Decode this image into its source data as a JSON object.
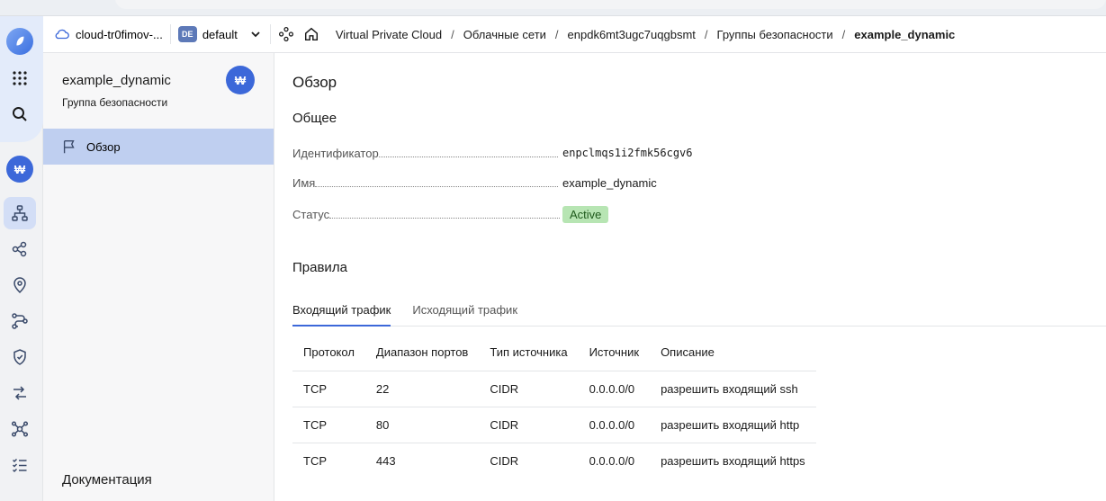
{
  "header": {
    "cloud_name": "cloud-tr0fimov-...",
    "folder_badge": "DE",
    "folder_name": "default",
    "breadcrumbs": [
      "Virtual Private Cloud",
      "Облачные сети",
      "enpdk6mt3ugc7uqgbsmt",
      "Группы безопасности",
      "example_dynamic"
    ],
    "breadcrumb_separator": "/"
  },
  "rail": {
    "avatar_letter": "₩",
    "icons": [
      "logo-icon",
      "apps-grid-icon",
      "search-icon",
      "avatar",
      "network-icon",
      "share-nodes-icon",
      "location-pin-icon",
      "routes-icon",
      "shield-icon",
      "transfer-arrows-icon",
      "cluster-icon",
      "checklist-icon"
    ]
  },
  "sidebar": {
    "title": "example_dynamic",
    "subtitle": "Группа безопасности",
    "avatar_letter": "₩",
    "items": [
      {
        "label": "Обзор",
        "icon": "flag-icon",
        "active": true
      }
    ],
    "docs_label": "Документация"
  },
  "main": {
    "page_title": "Обзор",
    "general": {
      "title": "Общее",
      "fields": [
        {
          "label": "Идентификатор",
          "value": "enpclmqs1i2fmk56cgv6"
        },
        {
          "label": "Имя",
          "value": "example_dynamic"
        },
        {
          "label": "Статус",
          "value": "Active"
        }
      ]
    },
    "rules": {
      "title": "Правила",
      "tabs": [
        "Входящий трафик",
        "Исходящий трафик"
      ],
      "active_tab": 0,
      "columns": [
        "Протокол",
        "Диапазон портов",
        "Тип источника",
        "Источник",
        "Описание"
      ],
      "rows": [
        [
          "TCP",
          "22",
          "CIDR",
          "0.0.0.0/0",
          "разрешить входящий ssh"
        ],
        [
          "TCP",
          "80",
          "CIDR",
          "0.0.0.0/0",
          "разрешить входящий http"
        ],
        [
          "TCP",
          "443",
          "CIDR",
          "0.0.0.0/0",
          "разрешить входящий https"
        ]
      ]
    }
  },
  "colors": {
    "accent": "#3c68d9",
    "active_nav": "#bfcff0",
    "status_active_bg": "#b7e5b3"
  }
}
